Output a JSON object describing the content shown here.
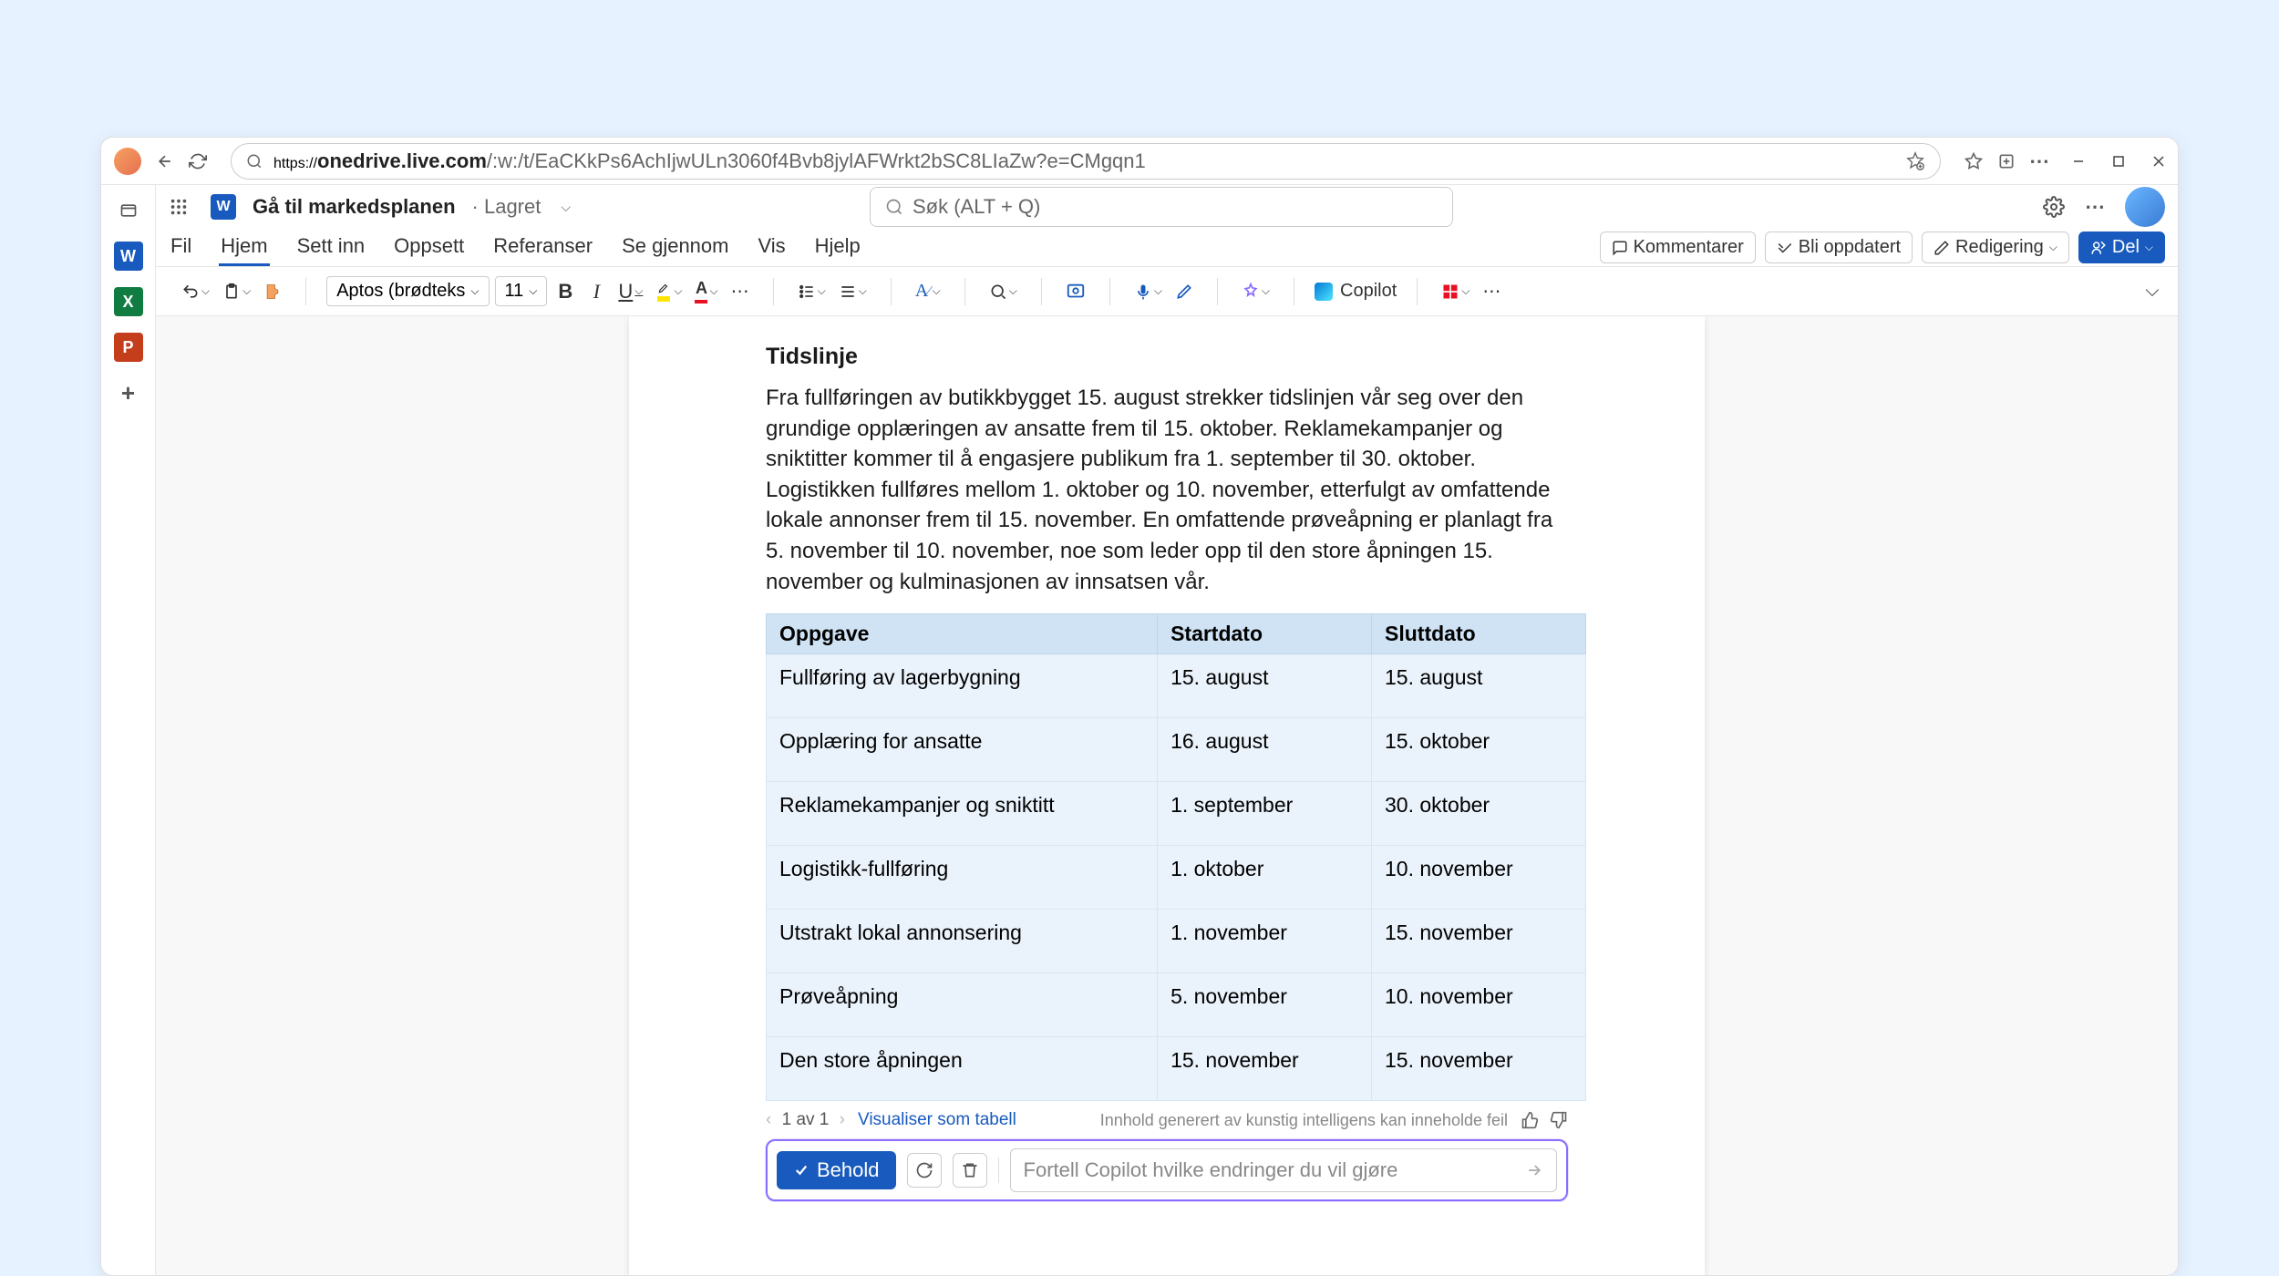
{
  "browser": {
    "url_host": "onedrive.live.com",
    "url_path": "/:w:/t/EaCKkPs6AchIjwULn3060f4Bvb8jylAFWrkt2bSC8LIaZw?e=CMgqn1"
  },
  "title_bar": {
    "doc_title": "Gå til markedsplanen",
    "saved_label": "· Lagret",
    "search_placeholder": "Søk (ALT + Q)"
  },
  "tabs": {
    "file": "Fil",
    "home": "Hjem",
    "insert": "Sett inn",
    "layout": "Oppsett",
    "references": "Referanser",
    "review": "Se gjennom",
    "view": "Vis",
    "help": "Hjelp",
    "comments": "Kommentarer",
    "catchup": "Bli oppdatert",
    "editing": "Redigering",
    "share": "Del"
  },
  "ribbon": {
    "font_name": "Aptos (brødteks",
    "font_size": "11",
    "copilot": "Copilot"
  },
  "document": {
    "heading": "Tidslinje",
    "paragraph": "Fra fullføringen av butikkbygget 15. august strekker tidslinjen vår seg over den grundige opplæringen av ansatte frem til 15. oktober. Reklamekampanjer og sniktitter kommer til å engasjere publikum fra 1. september til 30. oktober. Logistikken fullføres mellom 1. oktober og 10. november, etterfulgt av omfattende lokale annonser frem til 15. november. En omfattende prøveåpning er planlagt fra 5. november til 10. november, noe som leder opp til den store åpningen 15. november og kulminasjonen av innsatsen vår.",
    "th_task": "Oppgave",
    "th_start": "Startdato",
    "th_end": "Sluttdato",
    "rows": [
      {
        "task": "Fullføring av lagerbygning",
        "start": "15. august",
        "end": "15. august"
      },
      {
        "task": "Opplæring for ansatte",
        "start": "16. august",
        "end": "15. oktober"
      },
      {
        "task": "Reklamekampanjer og sniktitt",
        "start": "1. september",
        "end": "30. oktober"
      },
      {
        "task": "Logistikk-fullføring",
        "start": "1. oktober",
        "end": "10. november"
      },
      {
        "task": "Utstrakt lokal annonsering",
        "start": "1. november",
        "end": "15. november"
      },
      {
        "task": "Prøveåpning",
        "start": "5. november",
        "end": "10. november"
      },
      {
        "task": "Den store åpningen",
        "start": "15. november",
        "end": "15. november"
      }
    ]
  },
  "below": {
    "page_counter": "1 av 1",
    "visualize": "Visualiser som tabell",
    "disclaimer": "Innhold generert av kunstig intelligens kan inneholde feil"
  },
  "copilot_bar": {
    "keep": "Behold",
    "placeholder": "Fortell Copilot hvilke endringer du vil gjøre"
  }
}
